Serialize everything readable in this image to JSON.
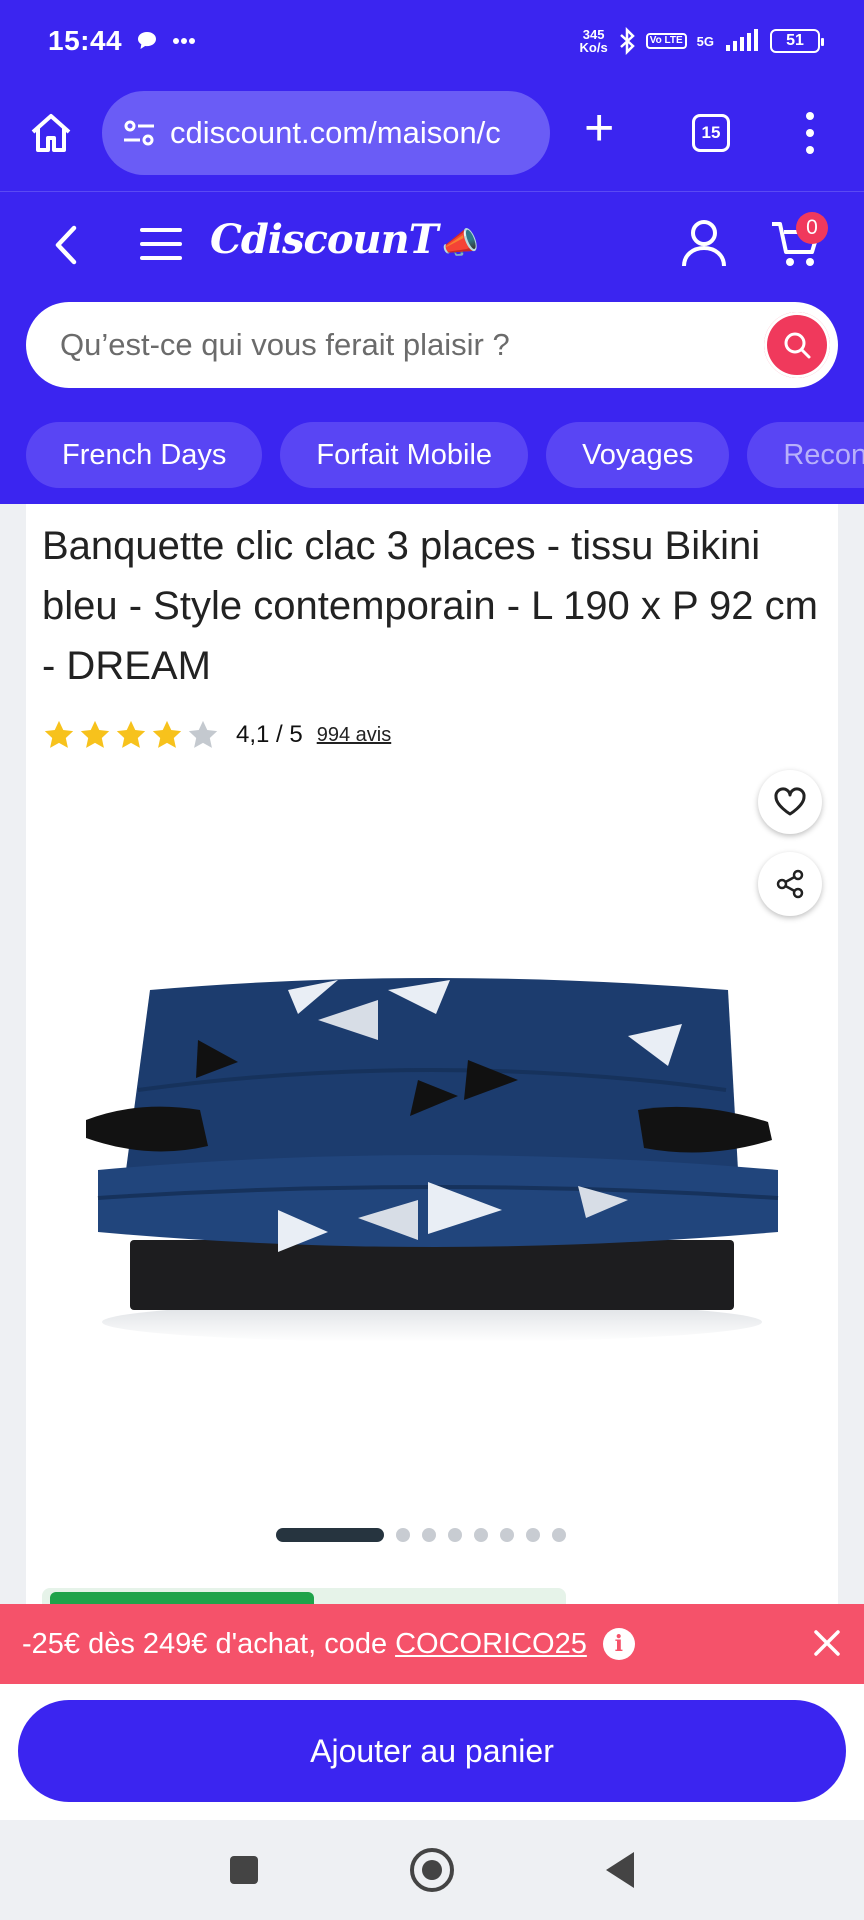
{
  "status_bar": {
    "time": "15:44",
    "speed_value": "345",
    "speed_unit": "Ko/s",
    "volte": "Vo LTE",
    "network": "5G",
    "battery": "51"
  },
  "browser": {
    "url": "cdiscount.com/maison/c",
    "tab_count": "15"
  },
  "header": {
    "logo": "CdiscounT",
    "cart_count": "0",
    "search_placeholder": "Qu’est-ce qui vous ferait plaisir ?"
  },
  "chips": [
    "French Days",
    "Forfait Mobile",
    "Voyages",
    "Recon"
  ],
  "product": {
    "title": "Banquette clic clac 3 places - tissu Bikini bleu - Style contemporain - L 190 x P 92 cm - DREAM",
    "rating_value": 4.1,
    "rating_text": "4,1 / 5",
    "reviews": "994 avis",
    "image_count": 8,
    "image_index": 1
  },
  "promo": {
    "text": "-25€ dès 249€ d'achat, code",
    "code": "COCORICO25",
    "info": "i"
  },
  "cta": {
    "label": "Ajouter au panier"
  },
  "colors": {
    "brand": "#3b25f0",
    "accent": "#f0395c",
    "promo": "#f5526a",
    "star": "#f7c21c"
  }
}
